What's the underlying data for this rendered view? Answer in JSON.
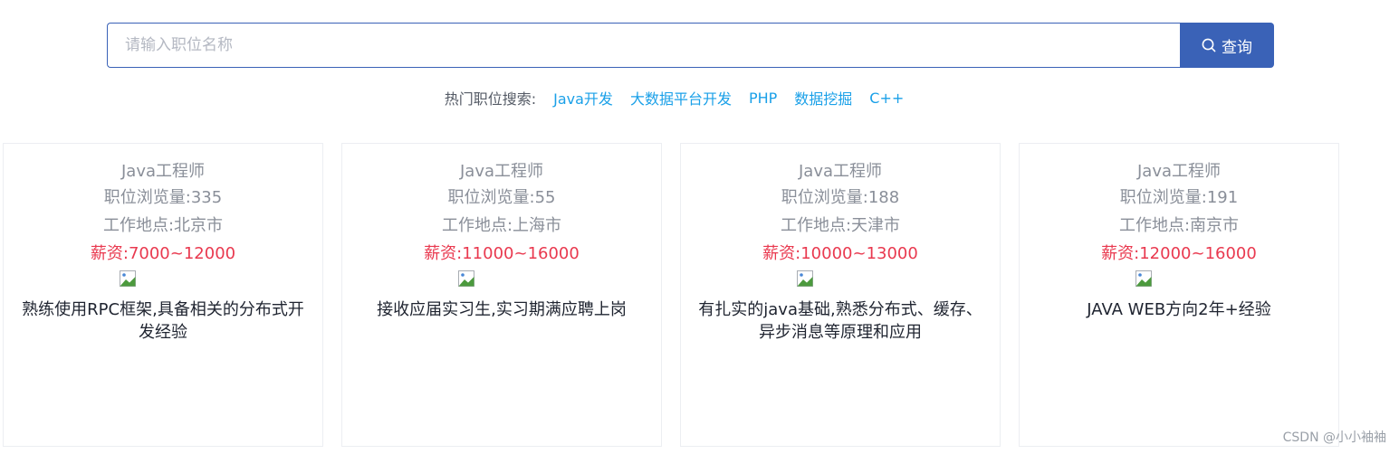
{
  "search": {
    "placeholder": "请输入职位名称",
    "button_label": "查询",
    "button_icon": "search-icon"
  },
  "hot_search": {
    "label": "热门职位搜索:",
    "links": [
      "Java开发",
      "大数据平台开发",
      "PHP",
      "数据挖掘",
      "C++"
    ]
  },
  "jobs": [
    {
      "title": "Java工程师",
      "views": "职位浏览量:335",
      "location": "工作地点:北京市",
      "salary": "薪资:7000~12000",
      "description": "熟练使用RPC框架,具备相关的分布式开发经验"
    },
    {
      "title": "Java工程师",
      "views": "职位浏览量:55",
      "location": "工作地点:上海市",
      "salary": "薪资:11000~16000",
      "description": "接收应届实习生,实习期满应聘上岗"
    },
    {
      "title": "Java工程师",
      "views": "职位浏览量:188",
      "location": "工作地点:天津市",
      "salary": "薪资:10000~13000",
      "description": "有扎实的java基础,熟悉分布式、缓存、异步消息等原理和应用"
    },
    {
      "title": "Java工程师",
      "views": "职位浏览量:191",
      "location": "工作地点:南京市",
      "salary": "薪资:12000~16000",
      "description": "JAVA WEB方向2年+经验"
    }
  ],
  "watermark": "CSDN @小小袖袖",
  "colors": {
    "accent": "#3a62b7",
    "link": "#1aa0e8",
    "salary": "#e9394f",
    "muted_text": "#8a8f99"
  }
}
